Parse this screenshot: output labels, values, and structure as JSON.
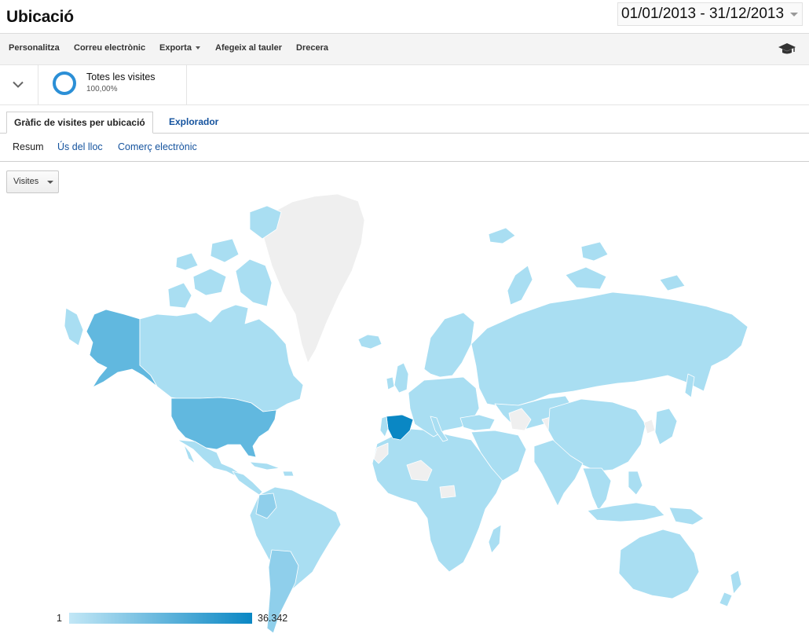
{
  "header": {
    "title": "Ubicació",
    "date_range": "01/01/2013 - 31/12/2013"
  },
  "toolbar": {
    "items": [
      "Personalitza",
      "Correu electrònic",
      "Exporta",
      "Afegeix al tauler",
      "Drecera"
    ],
    "help_icon": "graduation-cap-icon"
  },
  "segment": {
    "name": "Totes les visites",
    "percent": "100,00%",
    "ring_color": "#2b8fd6"
  },
  "tabs": {
    "active": "Gràfic de visites per ubicació",
    "other": "Explorador"
  },
  "subtabs": {
    "active": "Resum",
    "links": [
      "Ús del lloc",
      "Comerç electrònic"
    ]
  },
  "metric_select": {
    "value": "Visites"
  },
  "map_legend": {
    "min": "1",
    "max": "36.342",
    "color_low": "#c2e7f6",
    "color_high": "#0a87c4"
  },
  "map_colors": {
    "no_data": "#efefef",
    "base": "#a9def2",
    "usa": "#61b8df",
    "alaska": "#61b8df",
    "spain": "#0a87c4",
    "argentina": "#8fcfeb"
  }
}
